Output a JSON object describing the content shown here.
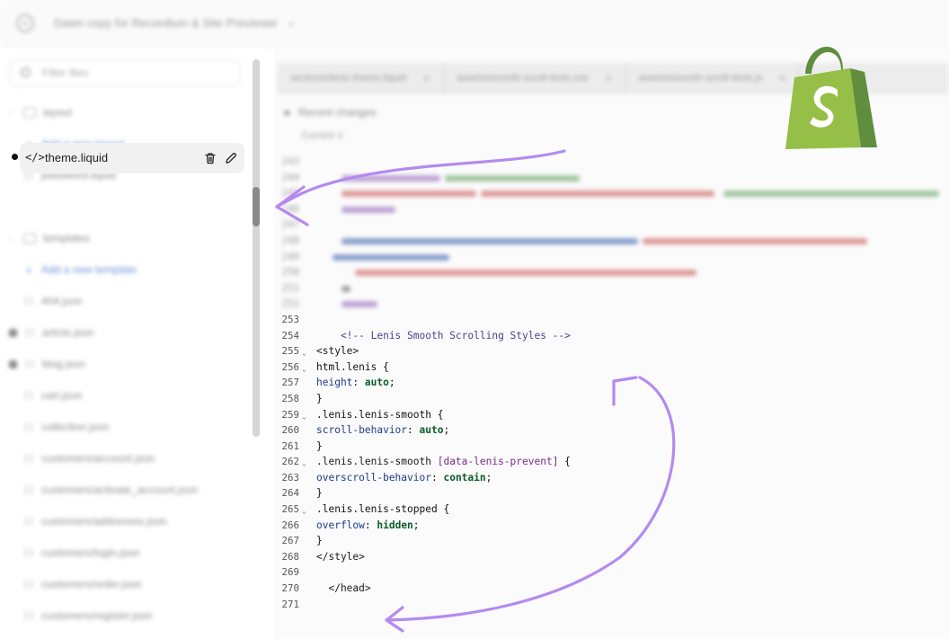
{
  "topbar": {
    "title": "Dawn copy for Recordium & Site Previewer",
    "more_icon": "chevron-down-icon"
  },
  "sidebar": {
    "filter_placeholder": "Filter files",
    "items": [
      {
        "kind": "folder",
        "label": "layout"
      },
      {
        "kind": "add",
        "label": "Add a new layout"
      },
      {
        "kind": "file",
        "label": "password.liquid"
      },
      {
        "kind": "active",
        "label": "theme.liquid"
      },
      {
        "kind": "folder",
        "label": "templates"
      },
      {
        "kind": "add",
        "label": "Add a new template"
      },
      {
        "kind": "file",
        "label": "404.json"
      },
      {
        "kind": "file-dot",
        "label": "article.json"
      },
      {
        "kind": "file-dot",
        "label": "blog.json"
      },
      {
        "kind": "file",
        "label": "cart.json"
      },
      {
        "kind": "file",
        "label": "collection.json"
      },
      {
        "kind": "file",
        "label": "customers/account.json"
      },
      {
        "kind": "file",
        "label": "customers/activate_account.json"
      },
      {
        "kind": "file",
        "label": "customers/addresses.json"
      },
      {
        "kind": "file",
        "label": "customers/login.json"
      },
      {
        "kind": "file",
        "label": "customers/order.json"
      },
      {
        "kind": "file",
        "label": "customers/register.json"
      }
    ]
  },
  "editor": {
    "tabs": [
      {
        "label": "sections/lenis-theme.liquid"
      },
      {
        "label": "assets/smooth-scroll-lenis.css"
      },
      {
        "label": "assets/smooth-scroll-lenis.js"
      }
    ],
    "recent_changes": "Recent changes",
    "recent_sub": "Current ∨",
    "blurred_line_numbers": [
      "243",
      "244",
      "245",
      "246",
      "247",
      "248",
      "249",
      "250",
      "251",
      "252"
    ],
    "lines": [
      {
        "n": "253",
        "fold": false,
        "text": ""
      },
      {
        "n": "254",
        "fold": false,
        "text": "    <!-- Lenis Smooth Scrolling Styles -->"
      },
      {
        "n": "255",
        "fold": true,
        "text": "<style>"
      },
      {
        "n": "256",
        "fold": true,
        "text": "html.lenis {"
      },
      {
        "n": "257",
        "fold": false,
        "text": "height: auto;"
      },
      {
        "n": "258",
        "fold": false,
        "text": "}"
      },
      {
        "n": "259",
        "fold": true,
        "text": ".lenis.lenis-smooth {"
      },
      {
        "n": "260",
        "fold": false,
        "text": "scroll-behavior: auto;"
      },
      {
        "n": "261",
        "fold": false,
        "text": "}"
      },
      {
        "n": "262",
        "fold": true,
        "text": ".lenis.lenis-smooth [data-lenis-prevent] {"
      },
      {
        "n": "263",
        "fold": false,
        "text": "overscroll-behavior: contain;"
      },
      {
        "n": "264",
        "fold": false,
        "text": "}"
      },
      {
        "n": "265",
        "fold": true,
        "text": ".lenis.lenis-stopped {"
      },
      {
        "n": "266",
        "fold": false,
        "text": "overflow: hidden;"
      },
      {
        "n": "267",
        "fold": false,
        "text": "}"
      },
      {
        "n": "268",
        "fold": false,
        "text": "</style>"
      },
      {
        "n": "269",
        "fold": false,
        "text": ""
      },
      {
        "n": "270",
        "fold": false,
        "text": "  </head>"
      },
      {
        "n": "271",
        "fold": false,
        "text": ""
      }
    ]
  },
  "colors": {
    "accent_arrow": "#b48af0",
    "shopify_green": "#95bf47",
    "shopify_dark_green": "#5e8e3e"
  },
  "icons": [
    "exit-icon",
    "search-icon",
    "code-icon",
    "trash-icon",
    "pencil-icon",
    "folder-icon",
    "chevron-icon",
    "shopify-logo-icon"
  ]
}
